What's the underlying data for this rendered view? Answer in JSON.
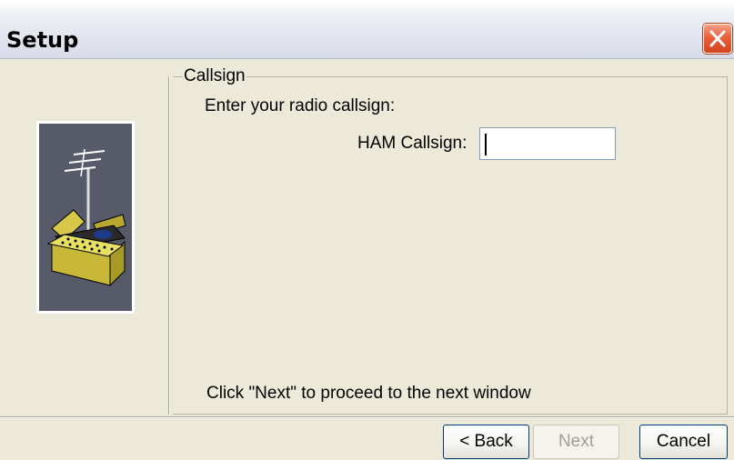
{
  "window": {
    "title": "Setup",
    "close_icon": "close-icon"
  },
  "side_image": {
    "icon": "antenna-box-illustration",
    "background_color": "#575a68"
  },
  "group": {
    "label": "Callsign",
    "prompt": "Enter your radio callsign:",
    "field_label": "HAM Callsign:",
    "field_value": "",
    "hint": "Click \"Next\" to proceed to the next window"
  },
  "buttons": {
    "back": "< Back",
    "next": "Next",
    "next_enabled": false,
    "cancel": "Cancel"
  }
}
